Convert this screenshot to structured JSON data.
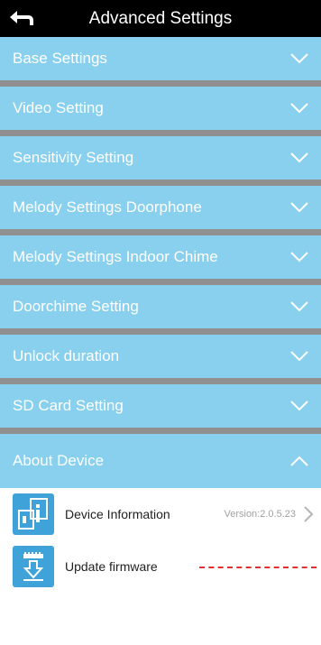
{
  "header": {
    "title": "Advanced Settings",
    "back_icon": "back-arrow-icon"
  },
  "sections": [
    {
      "label": "Base Settings",
      "state": "collapsed"
    },
    {
      "label": "Video Setting",
      "state": "collapsed"
    },
    {
      "label": "Sensitivity Setting",
      "state": "collapsed"
    },
    {
      "label": "Melody Settings Doorphone",
      "state": "collapsed"
    },
    {
      "label": "Melody Settings Indoor Chime",
      "state": "collapsed"
    },
    {
      "label": "Doorchime Setting",
      "state": "collapsed"
    },
    {
      "label": "Unlock duration",
      "state": "collapsed"
    },
    {
      "label": "SD Card Setting",
      "state": "collapsed"
    },
    {
      "label": "About Device",
      "state": "expanded"
    }
  ],
  "about": {
    "device_info": {
      "label": "Device Information",
      "version": "Version:2.0.5.23",
      "icon": "device-info-icon"
    },
    "update": {
      "label": "Update firmware",
      "icon": "firmware-update-icon"
    }
  },
  "colors": {
    "header_bg": "#000000",
    "section_bg": "#88d0ee",
    "separator": "#8f8f8f",
    "icon_bg": "#3fa3d9",
    "annotation": "#e23030"
  }
}
